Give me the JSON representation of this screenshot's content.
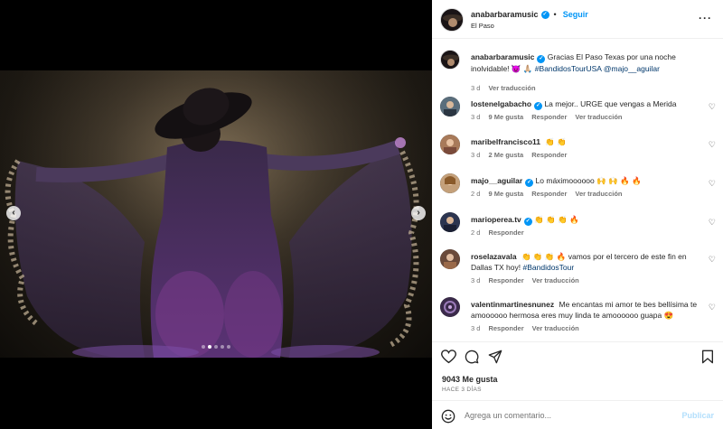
{
  "header": {
    "username": "anabarbaramusic",
    "separator": "•",
    "follow_label": "Seguir",
    "location": "El Paso",
    "more_icon": "more-horizontal-icon"
  },
  "caption": {
    "username": "anabarbaramusic",
    "text": "Gracias El Paso Texas por una noche inolvidable! 😈 🙏🏼",
    "hashtag": "#BandidosTourUSA",
    "mention": "@majo__aguilar",
    "time": "3 d",
    "translate": "Ver traducción"
  },
  "comments": [
    {
      "username": "lostenelgabacho",
      "verified": true,
      "text": "La mejor.. URGE que vengas a Merida",
      "time": "3 d",
      "likes": "9 Me gusta",
      "reply": "Responder",
      "translate": "Ver traducción"
    },
    {
      "username": "maribelfrancisco11",
      "verified": false,
      "text": "👏 👏",
      "time": "3 d",
      "likes": "2 Me gusta",
      "reply": "Responder",
      "translate": ""
    },
    {
      "username": "majo__aguilar",
      "verified": true,
      "text": "Lo máximoooooo 🙌 🙌 🔥 🔥",
      "time": "2 d",
      "likes": "9 Me gusta",
      "reply": "Responder",
      "translate": "Ver traducción"
    },
    {
      "username": "marioperea.tv",
      "verified": true,
      "text": "👏 👏 👏 🔥",
      "time": "2 d",
      "likes": "",
      "reply": "Responder",
      "translate": ""
    },
    {
      "username": "roselazavala",
      "verified": false,
      "text": "👏 👏 👏 🔥 vamos por el tercero de este fin en Dallas TX hoy!",
      "hashtag": "#BandidosTour",
      "time": "3 d",
      "likes": "",
      "reply": "Responder",
      "translate": "Ver traducción"
    },
    {
      "username": "valentinmartinesnunez",
      "verified": false,
      "text": "Me encantas mi amor te bes bellísima te amoooooo hermosa eres muy linda te amoooooo guapa 😍",
      "time": "3 d",
      "likes": "",
      "reply": "Responder",
      "translate": "Ver traducción"
    }
  ],
  "actions": {
    "icons": [
      "heart-icon",
      "comment-icon",
      "share-icon",
      "bookmark-icon"
    ],
    "likes": "9043 Me gusta",
    "posted": "HACE 3 DÍAS"
  },
  "add_comment": {
    "placeholder": "Agrega un comentario...",
    "publish": "Publicar"
  },
  "carousel": {
    "count": 5,
    "active": 2
  },
  "colors": {
    "link": "#0095f6",
    "muted": "#737373",
    "publish_disabled": "#b2dffc"
  }
}
